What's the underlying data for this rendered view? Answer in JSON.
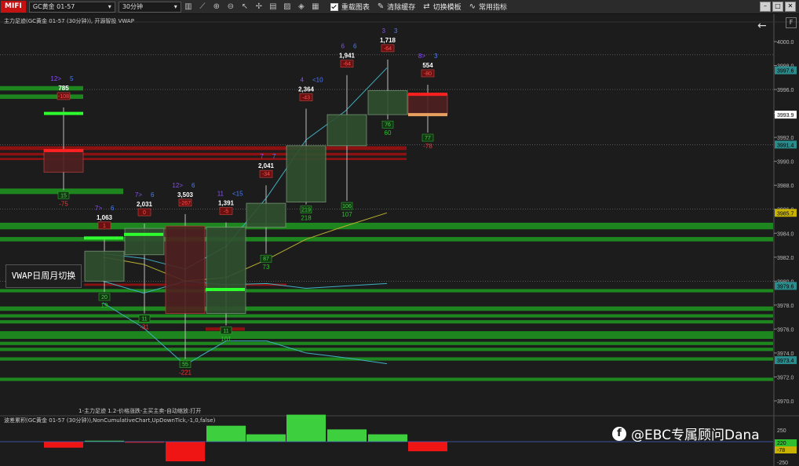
{
  "toolbar": {
    "logo": "MIFI",
    "symbol": "GC黄金 01-57",
    "timeframe": "30分钟",
    "load_chart": "重载图表",
    "clear_cache": "清除缓存",
    "switch_template": "切换模板",
    "common_indicators": "常用指标"
  },
  "chart": {
    "title": "主力足迹(GC黄金 01-57 (30分钟)), 开源智投 VWAP",
    "footer_note": "1-主力足迹 1.2-价格涨跌-主买主卖-自动缩放:打开",
    "vwap_button": "VWAP日周月切换",
    "sub_title": "波差累积(GC黄金 01-57 (30分钟)),NonCumulativeChart,UpDownTick,-1,0,false)",
    "f_button": "F"
  },
  "price_axis": {
    "ticks": [
      "4000.0",
      "3998.0",
      "3996.0",
      "3994.0",
      "3992.0",
      "3990.0",
      "3988.0",
      "3986.0",
      "3984.0",
      "3982.0",
      "3980.0",
      "3978.0",
      "3976.0",
      "3974.0",
      "3972.0",
      "3970.0"
    ],
    "highlights": [
      {
        "text": "3997.6",
        "color": "#2a8c8c",
        "price": 3997.6
      },
      {
        "text": "3993.9",
        "color": "#ffffff",
        "price": 3993.9
      },
      {
        "text": "3991.4",
        "color": "#2a8c8c",
        "price": 3991.4
      },
      {
        "text": "3985.7",
        "color": "#c8b400",
        "price": 3985.7
      },
      {
        "text": "3979.6",
        "color": "#2a8c8c",
        "price": 3979.6
      },
      {
        "text": "3973.4",
        "color": "#2a8c8c",
        "price": 3973.4
      }
    ]
  },
  "sub_axis": {
    "ticks": [
      "250",
      "0",
      "-250"
    ],
    "highlights": [
      {
        "text": "220",
        "color": "#2fbf2f"
      },
      {
        "text": "-78",
        "color": "#c8b400"
      }
    ]
  },
  "candles": [
    {
      "id": "c1",
      "open": 3989.1,
      "close": 3991.0,
      "high": 3994.5,
      "low": 3987.6,
      "top_left": "12>",
      "top_right": "5",
      "vol": "785",
      "delta": "-108",
      "bot_box": "15",
      "bot_val": "-75",
      "bot_color": "#ff3030",
      "rise": false,
      "diff": -49
    },
    {
      "id": "c2",
      "open": 3980.0,
      "close": 3982.5,
      "high": 3983.7,
      "low": 3979.1,
      "top_left": "7>",
      "top_right": "6",
      "vol": "1,063",
      "delta": "1",
      "bot_box": "20",
      "bot_val": "19",
      "bot_color": "#30c030",
      "rise": true,
      "diff": 8
    },
    {
      "id": "c3",
      "open": 3982.2,
      "close": 3984.4,
      "high": 3984.8,
      "low": 3977.3,
      "top_left": "7>",
      "top_right": "6",
      "vol": "2,031",
      "delta": "0",
      "bot_box": "11",
      "bot_val": "-31",
      "bot_color": "#ff3030",
      "rise": true,
      "diff": -8
    },
    {
      "id": "c4",
      "open": 3984.6,
      "close": 3977.3,
      "high": 3985.6,
      "low": 3973.5,
      "top_left": "12>",
      "top_right": "6",
      "vol": "3,503",
      "delta": "-267",
      "bot_box": "55",
      "bot_val": "-221",
      "bot_color": "#ff3030",
      "rise": false,
      "diff": -160
    },
    {
      "id": "c5",
      "open": 3977.3,
      "close": 3984.5,
      "high": 3984.9,
      "low": 3976.3,
      "top_left": "11",
      "top_right": "<15",
      "vol": "1,391",
      "delta": "-5",
      "bot_box": "11",
      "bot_val": "101",
      "bot_color": "#30c030",
      "rise": true,
      "diff": 130
    },
    {
      "id": "c6",
      "open": 3984.5,
      "close": 3986.5,
      "high": 3988.0,
      "low": 3982.3,
      "top_left": "7",
      "top_right": "7",
      "vol": "2,041",
      "delta": "-34",
      "bot_box": "87",
      "bot_val": "73",
      "bot_color": "#30c030",
      "rise": true,
      "diff": 60
    },
    {
      "id": "c7",
      "open": 3986.6,
      "close": 3991.3,
      "high": 3994.4,
      "low": 3986.4,
      "top_left": "4",
      "top_right": "<10",
      "vol": "2,364",
      "delta": "-43",
      "bot_box": "219",
      "bot_val": "218",
      "bot_color": "#30c030",
      "rise": true,
      "diff": 220
    },
    {
      "id": "c8",
      "open": 3991.3,
      "close": 3993.9,
      "high": 3997.2,
      "low": 3986.7,
      "top_left": "6",
      "top_right": "6",
      "vol": "1,941",
      "delta": "-64",
      "bot_box": "106",
      "bot_val": "107",
      "bot_color": "#30c030",
      "rise": true,
      "diff": 100
    },
    {
      "id": "c9",
      "open": 3993.9,
      "close": 3995.9,
      "high": 3998.5,
      "low": 3993.5,
      "top_left": "3",
      "top_right": "3",
      "vol": "1,718",
      "delta": "-64",
      "bot_box": "76",
      "bot_val": "60",
      "bot_color": "#30c030",
      "rise": true,
      "diff": 60
    },
    {
      "id": "c10",
      "open": 3995.6,
      "close": 3993.9,
      "high": 3996.4,
      "low": 3992.4,
      "top_left": "8>",
      "top_right": "3",
      "vol": "554",
      "delta": "-80",
      "bot_box": "77",
      "bot_val": "-78",
      "bot_color": "#ff3030",
      "rise": false,
      "diff": -78
    }
  ],
  "colors": {
    "background": "#1c1c1c",
    "green_band": "#1f8c1f",
    "red_band": "#a01010",
    "rise_candle": "#2f4f2f",
    "fall_candle": "#4f2020",
    "teal_line": "#3fb0c0",
    "yellow_line": "#b8b030"
  },
  "watermark": "@EBC专属顾问Dana"
}
